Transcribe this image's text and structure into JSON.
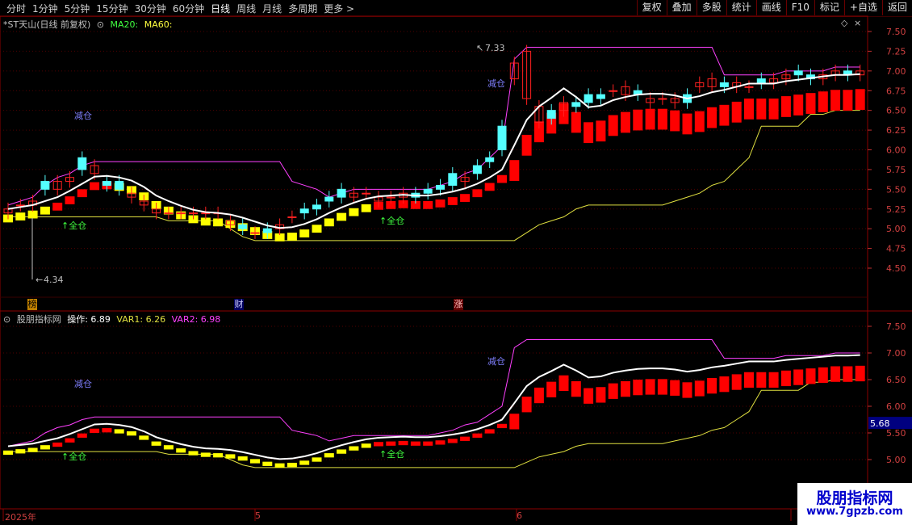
{
  "toolbar": {
    "tabs": [
      "分时",
      "1分钟",
      "5分钟",
      "15分钟",
      "30分钟",
      "60分钟",
      "日线",
      "周线",
      "月线",
      "多周期",
      "更多 >"
    ],
    "active_tab": "日线",
    "buttons": [
      "复权",
      "叠加",
      "多股",
      "统计",
      "画线",
      "F10",
      "标记",
      "+自选",
      "返回"
    ]
  },
  "upper_panel": {
    "title": "*ST天山(日线 前复权)",
    "ma20_label": "MA20:",
    "ma60_label": "MA60:",
    "y_ticks": [
      "7.50",
      "7.25",
      "7.00",
      "6.75",
      "6.50",
      "6.25",
      "6.00",
      "5.75",
      "5.50",
      "5.25",
      "5.00",
      "4.75",
      "4.50"
    ],
    "high_label": "7.33",
    "low_label": "4.34",
    "annotations": [
      "减仓",
      "↑全仓",
      "减仓",
      "↑全仓"
    ],
    "markers": [
      "榜",
      "财",
      "涨"
    ]
  },
  "lower_panel": {
    "title": "股朋指标网",
    "op_label": "操作: 6.89",
    "var1_label": "VAR1: 6.26",
    "var2_label": "VAR2: 6.98",
    "y_ticks": [
      "7.50",
      "7.00",
      "6.50",
      "6.00",
      "5.50",
      "5.00"
    ],
    "current_value": "5.68",
    "annotations": [
      "减仓",
      "↑全仓",
      "减仓",
      "↑全仓"
    ]
  },
  "date_axis": {
    "labels": [
      "2025年",
      "5",
      "6"
    ]
  },
  "watermark": {
    "title": "股朋指标网",
    "url": "www.7gpzb.com"
  },
  "colors": {
    "up": "#ff2020",
    "down": "#54ffff",
    "band_yellow": "#ffff00",
    "band_red": "#ff0000",
    "ma_white": "#ffffff",
    "var2_magenta": "#ff40ff",
    "var1_yellow": "#e0e040",
    "grid": "#8b0000"
  }
}
